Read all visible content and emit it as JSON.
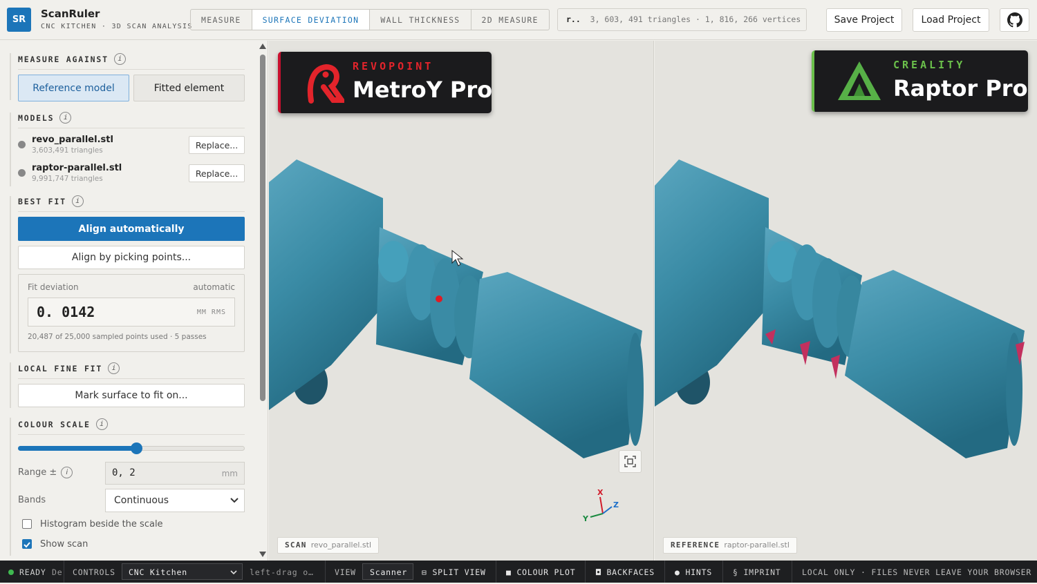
{
  "app": {
    "logo_text": "SR",
    "title": "ScanRuler",
    "subtitle": "CNC KITCHEN · 3D SCAN ANALYSIS",
    "brand_color": "#1c75b9"
  },
  "tabs": [
    {
      "label": "MEASURE",
      "active": false
    },
    {
      "label": "SURFACE DEVIATION",
      "active": true
    },
    {
      "label": "WALL THICKNESS",
      "active": false
    },
    {
      "label": "2D MEASURE",
      "active": false
    }
  ],
  "stats": {
    "name": "r..",
    "text": "3, 603, 491 triangles · 1, 816, 266 vertices"
  },
  "header_buttons": {
    "save": "Save Project",
    "load": "Load Project",
    "github_icon": "github-icon"
  },
  "sidebar": {
    "measure_against": {
      "title": "MEASURE AGAINST",
      "options": [
        {
          "label": "Reference model",
          "selected": true
        },
        {
          "label": "Fitted element",
          "selected": false
        }
      ]
    },
    "models": {
      "title": "MODELS",
      "items": [
        {
          "name": "revo_parallel.stl",
          "triangles": "3,603,491 triangles",
          "action": "Replace..."
        },
        {
          "name": "raptor-parallel.stl",
          "triangles": "9,991,747 triangles",
          "action": "Replace..."
        }
      ]
    },
    "best_fit": {
      "title": "BEST FIT",
      "align_auto": "Align automatically",
      "align_points": "Align by picking points...",
      "fit_label": "Fit deviation",
      "fit_mode": "automatic",
      "fit_value": "0. 0142",
      "fit_unit": "MM RMS",
      "fit_note": "20,487 of 25,000 sampled points used · 5 passes"
    },
    "local_fine_fit": {
      "title": "LOCAL FINE FIT",
      "button": "Mark surface to fit on..."
    },
    "colour_scale": {
      "title": "COLOUR SCALE",
      "slider_level": 0.52,
      "range_label": "Range ±",
      "range_value": "0, 2",
      "range_unit": "mm",
      "bands_label": "Bands",
      "bands_value": "Continuous",
      "histogram_label": "Histogram beside the scale",
      "histogram_checked": false,
      "show_scan_label": "Show scan",
      "show_scan_checked": true
    }
  },
  "viewports": {
    "left": {
      "brand_line": "REVOPOINT",
      "product": "MetroY Pro",
      "label_tag": "SCAN",
      "label_file": "revo_parallel.stl",
      "model_color": "#3a8ba5",
      "axis": {
        "x": "X",
        "y": "Y",
        "z": "Z"
      }
    },
    "right": {
      "brand_line": "CREALITY",
      "product": "Raptor Pro",
      "label_tag": "REFERENCE",
      "label_file": "raptor-parallel.stl",
      "model_color": "#3a8ba5",
      "deviation_color": "#c2305e"
    }
  },
  "statusbar": {
    "ready": "READY",
    "ready_trail": "De",
    "controls_label": "CONTROLS",
    "controls_value": "CNC Kitchen",
    "hint": "left-drag o…",
    "view_label": "VIEW",
    "view_value": "Scanner",
    "split_view": "SPLIT VIEW",
    "colour_plot": "COLOUR PLOT",
    "backfaces": "BACKFACES",
    "hints": "HINTS",
    "imprint": "IMPRINT",
    "local_only": "LOCAL ONLY · FILES NEVER LEAVE YOUR BROWSER"
  }
}
